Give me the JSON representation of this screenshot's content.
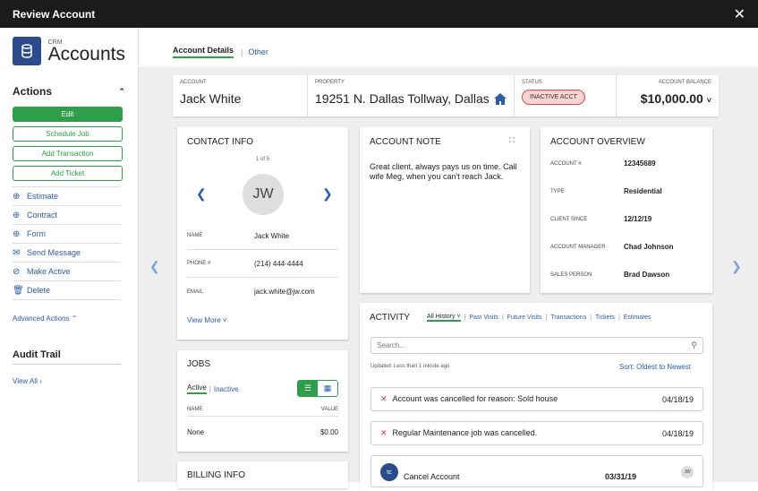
{
  "window": {
    "title": "Review Account",
    "close": "✕"
  },
  "sidebar": {
    "crm": "CRM",
    "title": "Accounts",
    "actions_title": "Actions",
    "actions_caret": "⌃",
    "buttons": {
      "edit": "Edit",
      "schedule": "Schedule Job",
      "transaction": "Add Transaction",
      "ticket": "Add Ticket"
    },
    "items": [
      {
        "label": "Estimate",
        "icon": "⊕"
      },
      {
        "label": "Contract",
        "icon": "⊕"
      },
      {
        "label": "Form",
        "icon": "⊕"
      },
      {
        "label": "Send Message",
        "icon": "✉"
      },
      {
        "label": "Make Active",
        "icon": "⊘"
      },
      {
        "label": "Delete",
        "icon": "🗑"
      }
    ],
    "advanced": "Advanced Actions ⌃",
    "audit_title": "Audit Trail",
    "view_all": "View All ›"
  },
  "tabs": {
    "details": "Account Details",
    "sep": "|",
    "other": "Other"
  },
  "summary": {
    "account_label": "ACCOUNT",
    "account": "Jack White",
    "property_label": "PROPERTY",
    "property": "19251 N. Dallas Tollway, Dallas",
    "status_label": "STATUS",
    "status": "INACTIVE ACCT",
    "balance_label": "ACCOUNT BALANCE",
    "balance": "$10,000.00",
    "balance_caret": "˅"
  },
  "contact": {
    "title": "CONTACT INFO",
    "pager": "1 of 5",
    "initials": "JW",
    "name_label": "NAME",
    "name": "Jack White",
    "phone_label": "PHONE #",
    "phone": "(214) 444-4444",
    "email_label": "EMAIL",
    "email": "jack.white@jw.com",
    "view_more": "View More ˅"
  },
  "note": {
    "title": "ACCOUNT NOTE",
    "text": "Great client, always pays us on time. Call wife Meg, when you can't reach Jack."
  },
  "overview": {
    "title": "ACCOUNT OVERVIEW",
    "rows": [
      {
        "label": "ACCOUNT #",
        "value": "12345689"
      },
      {
        "label": "TYPE",
        "value": "Residential"
      },
      {
        "label": "CLIENT SINCE",
        "value": "12/12/19"
      },
      {
        "label": "ACCOUNT MANAGER",
        "value": "Chad Johnson"
      },
      {
        "label": "SALES PERSON",
        "value": "Brad Dawson"
      }
    ]
  },
  "jobs": {
    "title": "JOBS",
    "active": "Active",
    "sep": "|",
    "inactive": "Inactive",
    "col_name": "NAME",
    "col_value": "VALUE",
    "row_name": "None",
    "row_value": "$0.00"
  },
  "billing": {
    "title": "BILLING INFO"
  },
  "activity": {
    "title": "ACTIVITY",
    "links": [
      "All History ˅",
      "Past Visits",
      "Future Visits",
      "Transactions",
      "Tickets",
      "Estimates"
    ],
    "search_placeholder": "Search...",
    "updated": "Updated: Less than 1 minute ago",
    "sort": "Sort: Oldest to Newest",
    "items": [
      {
        "text": "Account was cancelled for reason: Sold house",
        "date": "04/18/19"
      },
      {
        "text": "Regular Maintenance job was cancelled.",
        "date": "04/18/19"
      }
    ],
    "cancel_text": "Cancel Account",
    "cancel_date": "03/31/19",
    "cancel_avatar": "JW",
    "cancel_icon": "tc"
  }
}
